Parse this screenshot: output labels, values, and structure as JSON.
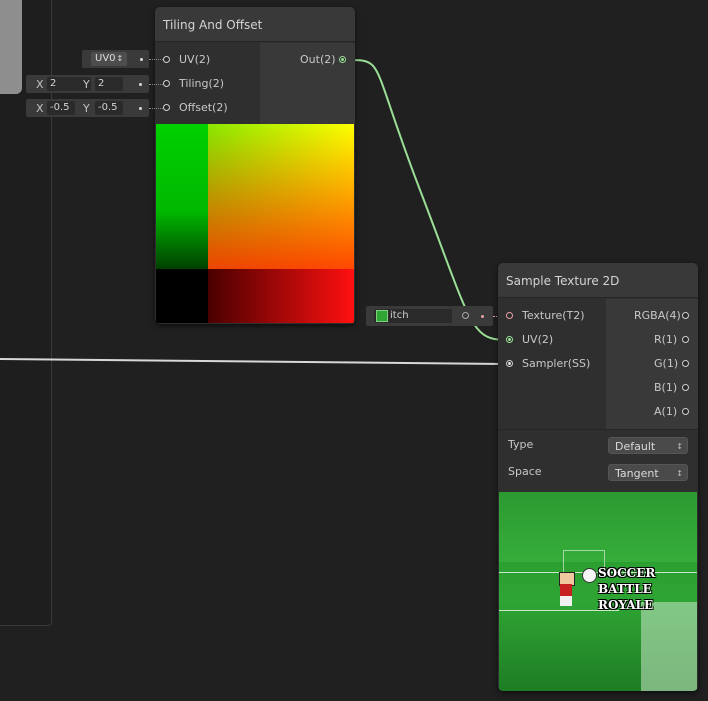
{
  "tiling_node": {
    "title": "Tiling And Offset",
    "inputs": [
      {
        "label": "UV(2)"
      },
      {
        "label": "Tiling(2)"
      },
      {
        "label": "Offset(2)"
      }
    ],
    "output": {
      "label": "Out(2)"
    },
    "uv_channel": {
      "value": "UV0",
      "arrow": "↕"
    },
    "tiling_field": {
      "x_label": "X",
      "x_value": "2",
      "y_label": "Y",
      "y_value": "2"
    },
    "offset_field": {
      "x_label": "X",
      "x_value": "-0.5",
      "y_label": "Y",
      "y_value": "-0.5"
    }
  },
  "sample_node": {
    "title": "Sample Texture 2D",
    "inputs": [
      {
        "label": "Texture(T2)"
      },
      {
        "label": "UV(2)"
      },
      {
        "label": "Sampler(SS)"
      }
    ],
    "outputs": [
      {
        "label": "RGBA(4)"
      },
      {
        "label": "R(1)"
      },
      {
        "label": "G(1)"
      },
      {
        "label": "B(1)"
      },
      {
        "label": "A(1)"
      }
    ],
    "texture_field": {
      "value": "itch"
    },
    "type_setting": {
      "label": "Type",
      "value": "Default"
    },
    "space_setting": {
      "label": "Space",
      "value": "Tangent"
    },
    "preview": {
      "line1": "SOCCER",
      "line2": "BATTLE",
      "line3": "ROYALE"
    }
  },
  "colors": {
    "wire_green": "#9adf95",
    "wire_white": "#d8d8d8",
    "node_bg": "#2f2f2f",
    "canvas_bg": "#202020"
  }
}
